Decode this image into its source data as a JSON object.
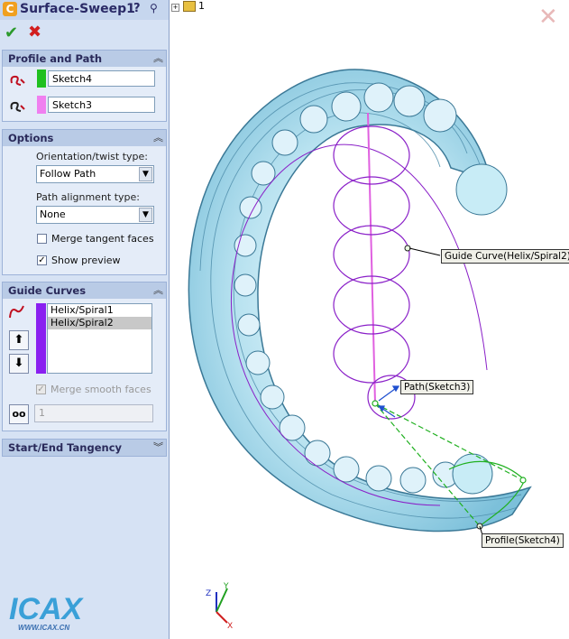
{
  "panel": {
    "title": "Surface-Sweep1",
    "help": "?",
    "pin": "⚲",
    "ok_symbol": "✔",
    "cancel_symbol": "✖"
  },
  "profile_path": {
    "header": "Profile and Path",
    "profile_value": "Sketch4",
    "path_value": "Sketch3",
    "profile_color": "#20c020",
    "path_color": "#f080f0"
  },
  "options": {
    "header": "Options",
    "orientation_label": "Orientation/twist type:",
    "orientation_value": "Follow Path",
    "alignment_label": "Path alignment type:",
    "alignment_value": "None",
    "merge_tangent_label": "Merge tangent faces",
    "merge_tangent_checked": false,
    "show_preview_label": "Show preview",
    "show_preview_checked": true
  },
  "guide_curves": {
    "header": "Guide Curves",
    "items": [
      "Helix/Spiral1",
      "Helix/Spiral2"
    ],
    "selected_index": 1,
    "merge_smooth_label": "Merge smooth faces",
    "spin_value": "1",
    "up_arrow": "⬆",
    "down_arrow": "⬇",
    "glasses": "oo"
  },
  "tangency": {
    "header": "Start/End Tangency"
  },
  "logo": {
    "text": "ICAX",
    "url_text": "WWW.ICAX.CN"
  },
  "viewport": {
    "tree_label": "1",
    "callouts": {
      "guide": "Guide Curve(Helix/Spiral2)",
      "path": "Path(Sketch3)",
      "profile": "Profile(Sketch4)"
    },
    "triad": {
      "x": "X",
      "y": "Y",
      "z": "Z"
    },
    "close": "✕"
  },
  "colors": {
    "surface": "#a8dcec",
    "surface_edge": "#3a7896",
    "helix": "#8a20c8",
    "path_line": "#e060e0",
    "profile_line": "#20b020"
  }
}
